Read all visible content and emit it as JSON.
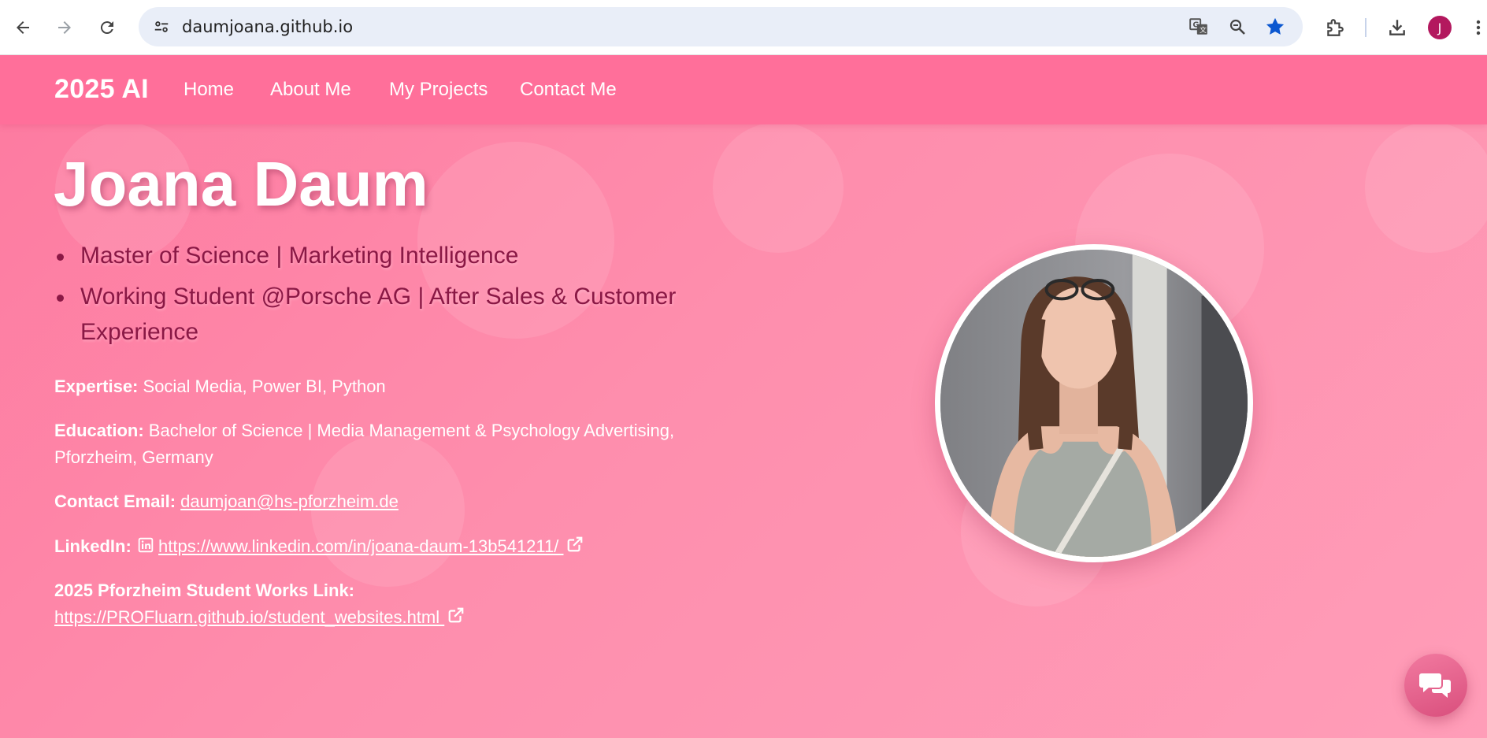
{
  "browser": {
    "url": "daumjoana.github.io",
    "profile_initial": "J"
  },
  "site": {
    "brand": "2025 AI",
    "nav": [
      "Home",
      "About Me",
      "My Projects",
      "Contact Me"
    ]
  },
  "hero": {
    "name": "Joana Daum",
    "bullets": [
      "Master of Science | Marketing Intelligence",
      "Working Student @Porsche AG | After Sales & Customer Experience"
    ]
  },
  "details": {
    "expertise_label": "Expertise:",
    "expertise_value": "Social Media, Power BI, Python",
    "education_label": "Education:",
    "education_value": "Bachelor of Science | Media Management & Psychology Advertising, Pforzheim, Germany",
    "email_label": "Contact Email:",
    "email_value": "daumjoan@hs-pforzheim.de",
    "linkedin_label": "LinkedIn:",
    "linkedin_value": " https://www.linkedin.com/in/joana-daum-13b541211/ ",
    "works_label": "2025 Pforzheim Student Works Link:",
    "works_value": "https://PROFluarn.github.io/student_websites.html "
  },
  "colors": {
    "nav_bg": "#ff6f9a",
    "page_bg": "#fe8ead",
    "bullet_text": "#8a1845",
    "profile_bg": "#b3185e",
    "star_blue": "#0b57d0"
  },
  "icons": [
    "back-arrow-icon",
    "forward-arrow-icon",
    "reload-icon",
    "site-info-icon",
    "translate-icon",
    "zoom-icon",
    "bookmark-star-icon",
    "extensions-icon",
    "download-icon",
    "more-vert-icon",
    "linkedin-icon",
    "external-link-icon",
    "chat-icon"
  ]
}
